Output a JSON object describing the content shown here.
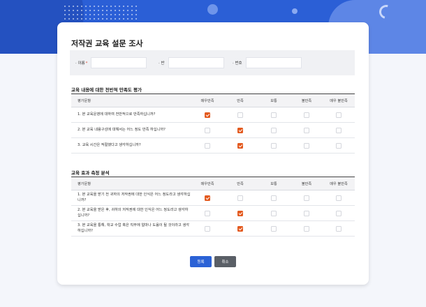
{
  "form": {
    "title": "저작권 교육 설문 조사",
    "fields": [
      {
        "label": "· 이름",
        "required": true,
        "value": ""
      },
      {
        "label": "· 반",
        "required": false,
        "value": ""
      },
      {
        "label": "· 번호",
        "required": false,
        "value": ""
      }
    ],
    "required_mark": "*"
  },
  "columns": [
    "평가문항",
    "매우만족",
    "만족",
    "보통",
    "불만족",
    "매우 불만족"
  ],
  "sections": [
    {
      "title": "교육 내용에 대한 전반적 만족도 평가",
      "questions": [
        {
          "text": "1. 본 교육운영에 대하여 전반적으로 만족하십니까?",
          "selected": 0
        },
        {
          "text": "2. 본 교육 내용구성에 대해서는 어느 정도 만족 하십니까?",
          "selected": 1
        },
        {
          "text": "3. 교육 시간은 적절했다고 생각하십니까?",
          "selected": 1
        }
      ]
    },
    {
      "title": "교육 효과 측정 분석",
      "questions": [
        {
          "text": "1. 본 교육을 받기 전 귀하의 저작권에 대한 인식은 어느 정도라고 생각하십니까?",
          "selected": 0
        },
        {
          "text": "2. 본 교육을 받은 후, 귀하의 저작권에 대한 인식은 어느 정도라고 생각하십니까?",
          "selected": 1
        },
        {
          "text": "3. 본 교육을 통해, 학교 수업 혹은 직무에 얼마나 도움이 될 것이라고 생각하십니까?",
          "selected": 1
        }
      ]
    }
  ],
  "buttons": {
    "submit": "등록",
    "cancel": "취소"
  },
  "colors": {
    "header": "#2b5fd6",
    "checked": "#e35a1f",
    "submit": "#2b62d6",
    "cancel": "#5a5f66"
  }
}
